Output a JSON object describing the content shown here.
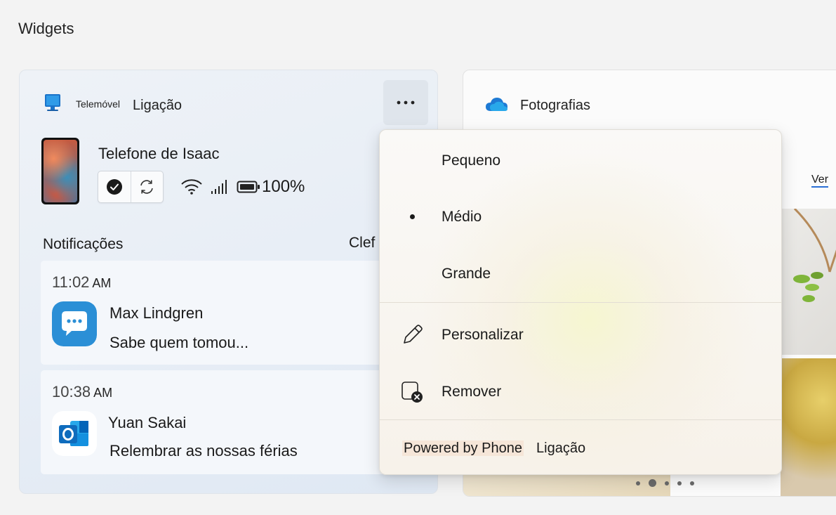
{
  "page": {
    "title": "Widgets"
  },
  "phone_widget": {
    "title_small": "Telemóvel",
    "title_big": "Ligação",
    "device_name": "Telefone de Isaac",
    "battery": "100%",
    "notifications_title": "Notificações",
    "clear_partial": "Clef",
    "notifications": [
      {
        "time": "11:02",
        "ampm": "AM",
        "sender": "Max Lindgren",
        "text": "Sabe quem tomou...",
        "app_icon": "messages-icon"
      },
      {
        "time": "10:38",
        "ampm": "AM",
        "sender": "Yuan Sakai",
        "text": "Relembrar as nossas férias",
        "app_icon": "outlook-icon"
      }
    ]
  },
  "photos_widget": {
    "title": "Fotografias",
    "see_link": "Ver",
    "carousel": {
      "count": 5,
      "active_index": 1
    }
  },
  "context_menu": {
    "items": [
      {
        "label": "Pequeno",
        "selected": false
      },
      {
        "label": "Médio",
        "selected": true
      },
      {
        "label": "Grande",
        "selected": false
      }
    ],
    "customize_label": "Personalizar",
    "remove_label": "Remover",
    "powered_by": "Powered by Phone",
    "powered_by_app": "Ligação"
  },
  "colors": {
    "accent_blue": "#2a6fd6",
    "messages_blue": "#2b8fd6",
    "outlook_blue": "#0f6cbd",
    "onedrive_blue": "#1e7ad4"
  }
}
